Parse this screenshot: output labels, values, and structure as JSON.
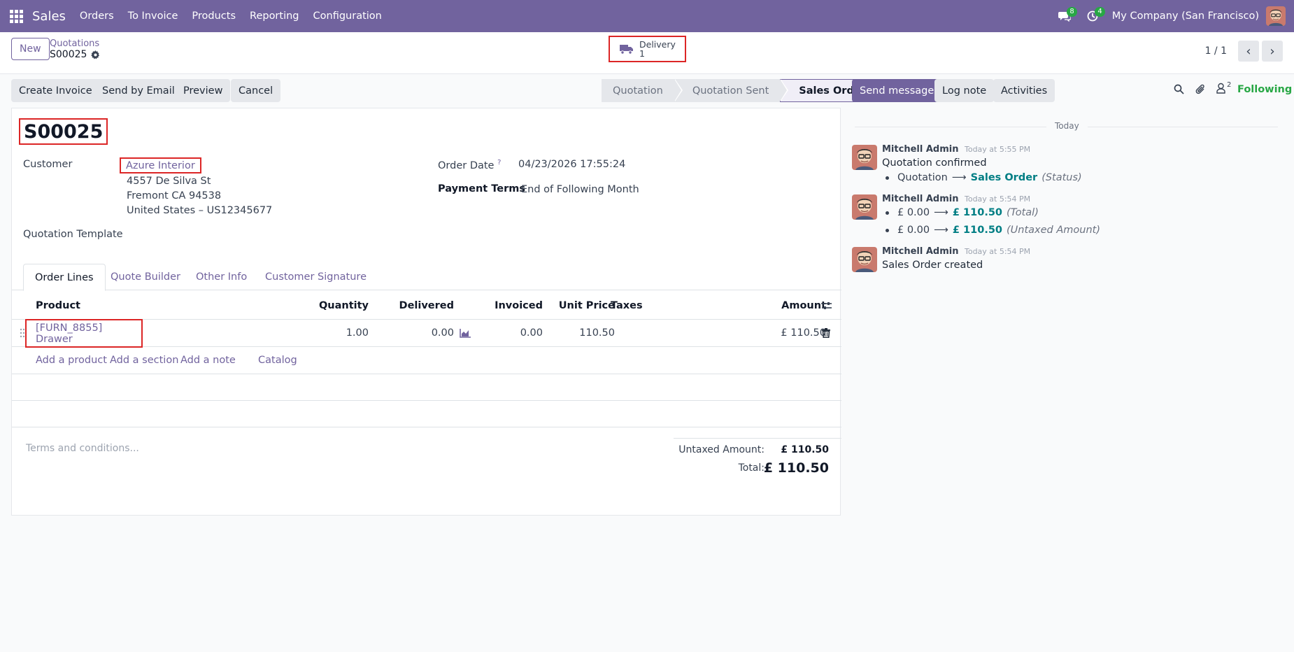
{
  "navbar": {
    "brand": "Sales",
    "menu": [
      "Orders",
      "To Invoice",
      "Products",
      "Reporting",
      "Configuration"
    ],
    "messages_count": "8",
    "activities_count": "4",
    "company": "My Company (San Francisco)"
  },
  "control": {
    "new_label": "New",
    "breadcrumb_parent": "Quotations",
    "breadcrumb_current": "S00025",
    "delivery_label": "Delivery",
    "delivery_count": "1",
    "pager_value": "1 / 1"
  },
  "actions": {
    "create_invoice": "Create Invoice",
    "send_email": "Send by Email",
    "preview": "Preview",
    "cancel": "Cancel"
  },
  "statusbar": [
    "Quotation",
    "Quotation Sent",
    "Sales Order"
  ],
  "form": {
    "order_name": "S00025",
    "customer_label": "Customer",
    "customer_name": "Azure Interior",
    "address_1": "4557 De Silva St",
    "address_2": "Fremont CA 94538",
    "address_3": "United States – US12345677",
    "order_date_label": "Order Date",
    "order_date_help": "?",
    "order_date": "04/23/2026 17:55:24",
    "payment_terms_label": "Payment Terms",
    "payment_terms": "End of Following Month",
    "template_label": "Quotation Template"
  },
  "tabs": [
    "Order Lines",
    "Quote Builder",
    "Other Info",
    "Customer Signature"
  ],
  "table": {
    "headers": {
      "product": "Product",
      "quantity": "Quantity",
      "delivered": "Delivered",
      "invoiced": "Invoiced",
      "unit_price": "Unit Price",
      "taxes": "Taxes",
      "amount": "Amount"
    },
    "rows": [
      {
        "product": "[FURN_8855] Drawer",
        "quantity": "1.00",
        "delivered": "0.00",
        "invoiced": "0.00",
        "unit_price": "110.50",
        "taxes": "",
        "amount": "£ 110.50"
      }
    ],
    "add_product": "Add a product",
    "add_section": "Add a section",
    "add_note": "Add a note",
    "catalog": "Catalog"
  },
  "terms_placeholder": "Terms and conditions...",
  "totals": {
    "untaxed_label": "Untaxed Amount:",
    "untaxed_value": "£ 110.50",
    "total_label": "Total:",
    "total_value": "£ 110.50"
  },
  "chatter": {
    "send_message": "Send message",
    "log_note": "Log note",
    "activities": "Activities",
    "followers_count": "2",
    "following": "Following",
    "date_separator": "Today",
    "messages": [
      {
        "author": "Mitchell Admin",
        "time": "Today at 5:55 PM",
        "body": "Quotation confirmed",
        "old": "Quotation",
        "new": "Sales Order",
        "field": "(Status)"
      },
      {
        "author": "Mitchell Admin",
        "time": "Today at 5:54 PM",
        "changes": [
          {
            "old": "£ 0.00",
            "new": "£ 110.50",
            "field": "(Total)"
          },
          {
            "old": "£ 0.00",
            "new": "£ 110.50",
            "field": "(Untaxed Amount)"
          }
        ]
      },
      {
        "author": "Mitchell Admin",
        "time": "Today at 5:54 PM",
        "body": "Sales Order created"
      }
    ]
  },
  "colors": {
    "brand": "#71639e",
    "highlight_box": "#dc2626",
    "accent_link": "#017e84",
    "badge": "#28a745",
    "following": "#28a745"
  }
}
